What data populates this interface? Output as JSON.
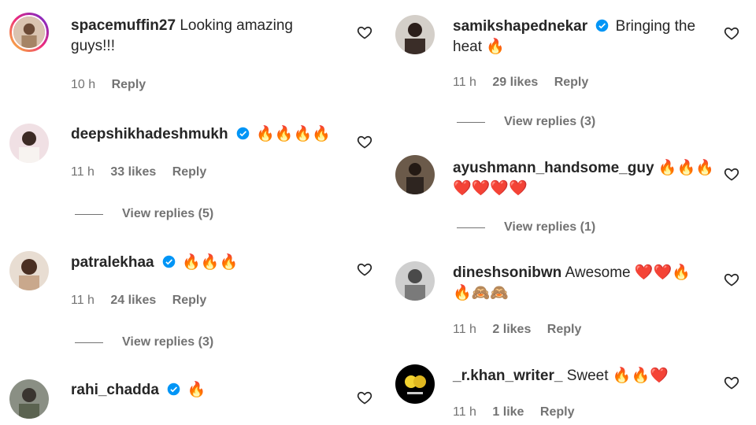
{
  "left_column": [
    {
      "username": "spacemuffin27",
      "verified": false,
      "text": "Looking amazing guys!!!",
      "time": "10 h",
      "likes": "",
      "reply": "Reply",
      "view_replies": "",
      "avatar_icon": "profile-photo"
    },
    {
      "username": "deepshikhadeshmukh",
      "verified": true,
      "text": "🔥🔥🔥🔥",
      "time": "11 h",
      "likes": "33 likes",
      "reply": "Reply",
      "view_replies": "View replies (5)",
      "avatar_icon": "profile-photo"
    },
    {
      "username": "patralekhaa",
      "verified": true,
      "text": "🔥🔥🔥",
      "time": "11 h",
      "likes": "24 likes",
      "reply": "Reply",
      "view_replies": "View replies (3)",
      "avatar_icon": "profile-photo"
    },
    {
      "username": "rahi_chadda",
      "verified": true,
      "text": "🔥",
      "time": "",
      "likes": "",
      "reply": "",
      "view_replies": "",
      "avatar_icon": "profile-photo"
    }
  ],
  "right_column": [
    {
      "username": "samikshapednekar",
      "verified": true,
      "text": "Bringing the heat 🔥",
      "time": "11 h",
      "likes": "29 likes",
      "reply": "Reply",
      "view_replies": "View replies (3)",
      "avatar_icon": "profile-photo"
    },
    {
      "username": "ayushmann_handsome_guy",
      "verified": false,
      "text": "🔥🔥🔥 ❤️❤️❤️❤️",
      "time": "",
      "likes": "",
      "reply": "",
      "view_replies": "View replies (1)",
      "avatar_icon": "profile-photo"
    },
    {
      "username": "dineshsonibwn",
      "verified": false,
      "text": "Awesome ❤️❤️🔥 🔥🙈🙈",
      "time": "11 h",
      "likes": "2 likes",
      "reply": "Reply",
      "view_replies": "",
      "avatar_icon": "profile-photo"
    },
    {
      "username": "_r.khan_writer_",
      "verified": false,
      "text": "Sweet 🔥🔥❤️",
      "time": "11 h",
      "likes": "1 like",
      "reply": "Reply",
      "view_replies": "",
      "avatar_icon": "profile-photo"
    }
  ],
  "colors": {
    "text": "#262626",
    "secondary": "#737373",
    "verified": "#0095f6"
  }
}
